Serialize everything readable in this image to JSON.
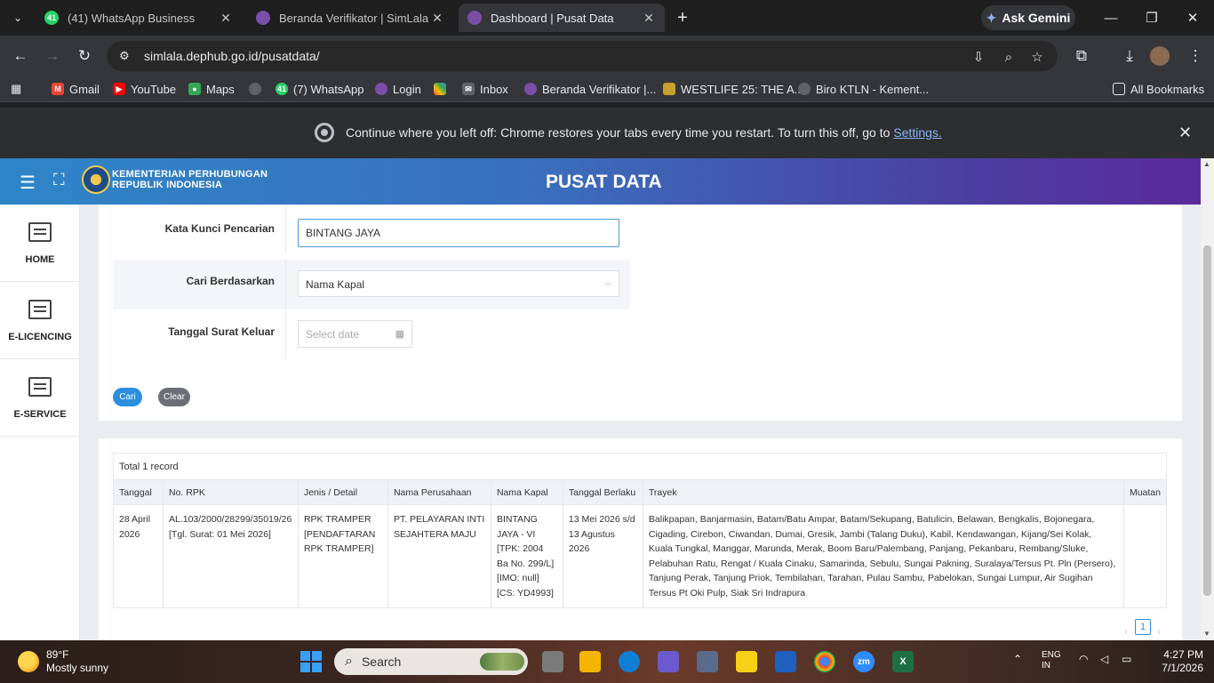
{
  "browser": {
    "tabs": [
      {
        "label": "(41) WhatsApp Business",
        "badge": "41",
        "active": false
      },
      {
        "label": "Beranda Verifikator | SimLala",
        "active": false
      },
      {
        "label": "Dashboard | Pusat Data",
        "active": true
      }
    ],
    "gemini_label": "Ask Gemini",
    "url": "simlala.dephub.go.id/pusatdata/",
    "bookmarks": [
      {
        "label": "Gmail"
      },
      {
        "label": "YouTube"
      },
      {
        "label": "Maps"
      },
      {
        "label": "(7) WhatsApp",
        "badge": "41"
      },
      {
        "label": "Login"
      },
      {
        "label": "Inbox"
      },
      {
        "label": "Beranda Verifikator |..."
      },
      {
        "label": "WESTLIFE 25: THE A..."
      },
      {
        "label": "Biro KTLN - Kement..."
      }
    ],
    "all_bookmarks": "All Bookmarks",
    "infobar": {
      "message": "Continue where you left off: Chrome restores your tabs every time you restart. To turn this off, go to ",
      "link": "Settings."
    }
  },
  "app": {
    "org_line1": "KEMENTERIAN PERHUBUNGAN",
    "org_line2": "REPUBLIK INDONESIA",
    "title": "PUSAT DATA",
    "sidebar": [
      {
        "label": "HOME"
      },
      {
        "label": "E-LICENCING"
      },
      {
        "label": "E-SERVICE"
      }
    ],
    "form": {
      "keyword_label": "Kata Kunci Pencarian",
      "keyword_value": "BINTANG JAYA",
      "search_by_label": "Cari Berdasarkan",
      "search_by_value": "Nama Kapal",
      "date_label": "Tanggal Surat Keluar",
      "date_placeholder": "Select date",
      "search_button": "Cari",
      "clear_button": "Clear"
    },
    "results": {
      "total": "Total 1 record",
      "columns": [
        "Tanggal",
        "No. RPK",
        "Jenis / Detail",
        "Nama Perusahaan",
        "Nama Kapal",
        "Tanggal Berlaku",
        "Trayek",
        "Muatan"
      ],
      "rows": [
        {
          "tanggal": "28 April 2026",
          "no_rpk": "AL.103/2000/28299/35019/26 [Tgl. Surat: 01 Mei 2026]",
          "jenis": "RPK TRAMPER [PENDAFTARAN RPK TRAMPER]",
          "perusahaan": "PT. PELAYARAN INTI SEJAHTERA MAJU",
          "kapal": "BINTANG JAYA - VI [TPK: 2004 Ba No. 299/L] [IMO: null] [CS: YD4993]",
          "berlaku": "13 Mei 2026 s/d 13 Agustus 2026",
          "trayek": "Balikpapan, Banjarmasin, Batam/Batu Ampar, Batam/Sekupang, Batulicin, Belawan, Bengkalis, Bojonegara, Cigading, Cirebon, Ciwandan, Dumai, Gresik, Jambi (Talang Duku), Kabil, Kendawangan, Kijang/Sei Kolak, Kuala Tungkal, Manggar, Marunda, Merak, Boom Baru/Palembang, Panjang, Pekanbaru, Rembang/Sluke, Pelabuhan Ratu, Rengat / Kuala Cinaku, Samarinda, Sebulu, Sungai Pakning, Suralaya/Tersus Pt. Pln (Persero), Tanjung Perak, Tanjung Priok, Tembilahan, Tarahan, Pulau Sambu, Pabelokan, Sungai Lumpur, Air Sugihan Tersus Pt Oki Pulp, Siak Sri Indrapura",
          "muatan": ""
        }
      ],
      "current_page": "1"
    }
  },
  "taskbar": {
    "temp": "89°F",
    "condition": "Mostly sunny",
    "search_label": "Search",
    "lang1": "ENG",
    "lang2": "IN",
    "time": "4:27 PM",
    "date": "7/1/2026"
  },
  "colors": {
    "header_start": "#2e86c7",
    "header_end": "#5a2a9a",
    "primary_button": "#2b8fde",
    "secondary_button": "#6b6f77"
  }
}
